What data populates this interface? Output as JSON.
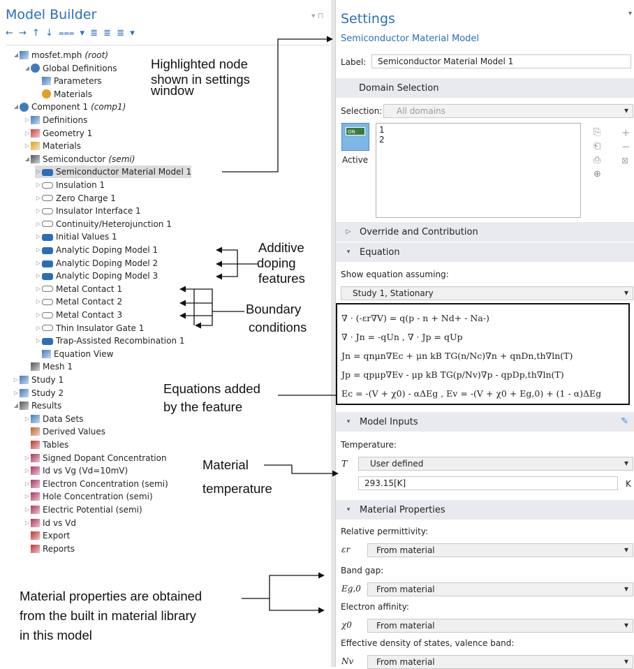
{
  "model_builder": {
    "title": "Model Builder",
    "toolbar": "← → ↑ ↓ ⩶ ▾ ≣ ≣ ≣ ▾",
    "tree": [
      {
        "label": "mosfet.mph",
        "suffix": "(root)"
      },
      {
        "label": "Global Definitions"
      },
      {
        "label": "Parameters"
      },
      {
        "label": "Materials"
      },
      {
        "label": "Component 1",
        "suffix": "(comp1)"
      },
      {
        "label": "Definitions"
      },
      {
        "label": "Geometry 1"
      },
      {
        "label": "Materials"
      },
      {
        "label": "Semiconductor",
        "suffix": "(semi)"
      },
      {
        "label": "Semiconductor Material Model 1"
      },
      {
        "label": "Insulation 1"
      },
      {
        "label": "Zero Charge 1"
      },
      {
        "label": "Insulator Interface 1"
      },
      {
        "label": "Continuity/Heterojunction 1"
      },
      {
        "label": "Initial Values 1"
      },
      {
        "label": "Analytic Doping Model 1"
      },
      {
        "label": "Analytic Doping Model 2"
      },
      {
        "label": "Analytic Doping Model 3"
      },
      {
        "label": "Metal Contact 1"
      },
      {
        "label": "Metal Contact 2"
      },
      {
        "label": "Metal Contact 3"
      },
      {
        "label": "Thin Insulator Gate 1"
      },
      {
        "label": "Trap-Assisted Recombination 1"
      },
      {
        "label": "Equation View"
      },
      {
        "label": "Mesh 1"
      },
      {
        "label": "Study 1"
      },
      {
        "label": "Study 2"
      },
      {
        "label": "Results"
      },
      {
        "label": "Data Sets"
      },
      {
        "label": "Derived Values"
      },
      {
        "label": "Tables"
      },
      {
        "label": "Signed Dopant Concentration"
      },
      {
        "label": "Id vs Vg (Vd=10mV)"
      },
      {
        "label": "Electron Concentration (semi)"
      },
      {
        "label": "Hole Concentration (semi)"
      },
      {
        "label": "Electric Potential (semi)"
      },
      {
        "label": "Id vs Vd"
      },
      {
        "label": "Export"
      },
      {
        "label": "Reports"
      }
    ]
  },
  "annotations": {
    "highlighted": [
      "Highlighted node",
      "shown in settings",
      "window"
    ],
    "additive": [
      "Additive",
      "doping",
      "features"
    ],
    "boundary": [
      "Boundary",
      "conditions"
    ],
    "equations": [
      "Equations added",
      "by the feature"
    ],
    "material_temp": [
      "Material",
      "temperature"
    ],
    "material_props": [
      "Material properties are obtained",
      "from the built in material library",
      "in this model"
    ]
  },
  "settings": {
    "title": "Settings",
    "subtitle": "Semiconductor Material Model",
    "label_caption": "Label:",
    "label_value": "Semiconductor Material Model 1",
    "domain_selection": "Domain Selection",
    "selection_caption": "Selection:",
    "selection_value": "All domains",
    "domains": [
      "1",
      "2"
    ],
    "active_badge": "ON",
    "active_label": "Active",
    "override": "Override and Contribution",
    "equation": "Equation",
    "show_eq": "Show equation assuming:",
    "study": "Study 1, Stationary",
    "model_inputs": "Model Inputs",
    "temperature_caption": "Temperature:",
    "T_symbol": "T",
    "temperature_mode": "User defined",
    "temperature_value": "293.15[K]",
    "temperature_unit": "K",
    "material_properties": "Material Properties",
    "props": [
      {
        "caption": "Relative permittivity:",
        "symbol": "εr",
        "value": "From material"
      },
      {
        "caption": "Band gap:",
        "symbol": "Eg,0",
        "value": "From material"
      },
      {
        "caption": "Electron affinity:",
        "symbol": "χ0",
        "value": "From material"
      },
      {
        "caption": "Effective density of states, valence band:",
        "symbol": "Nv",
        "value": "From material"
      }
    ]
  },
  "equations": [
    "∇ · (-εr∇V) = q(p - n + Nd+ - Na-)",
    "∇ · Jn = -qUn ,    ∇ · Jp = qUp",
    "Jn = qnμn∇Ec + μn kB TG(n/Nc)∇n + qnDn,th∇ln(T)",
    "Jp = qpμp∇Ev - μp kB TG(p/Nv)∇p - qpDp,th∇ln(T)",
    "Ec = -(V + χ0) - αΔEg ,   Ev = -(V + χ0 + Eg,0) + (1 - α)ΔEg"
  ]
}
